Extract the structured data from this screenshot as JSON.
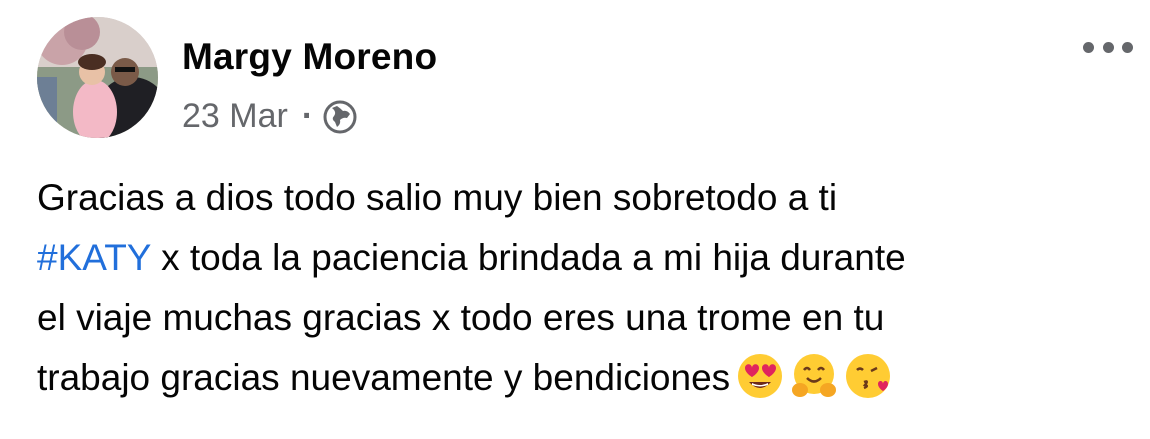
{
  "post": {
    "author": "Margy Moreno",
    "date": "23 Mar",
    "separator": "·",
    "privacy_icon": "globe-icon",
    "more_icon": "more-options-icon",
    "text_lines": [
      "Gracias a dios todo salio muy bien sobretodo a ti",
      "x toda la paciencia brindada a mi hija durante",
      "el viaje muchas gracias x todo eres una trome en tu",
      "trabajo gracias nuevamente y bendiciones"
    ],
    "hashtag": "#KATY",
    "emojis": [
      "heart-eyes-emoji",
      "hugging-emoji",
      "kissing-heart-emoji"
    ],
    "colors": {
      "hashtag": "#216fdb",
      "meta": "#65676b",
      "text": "#050505"
    }
  }
}
